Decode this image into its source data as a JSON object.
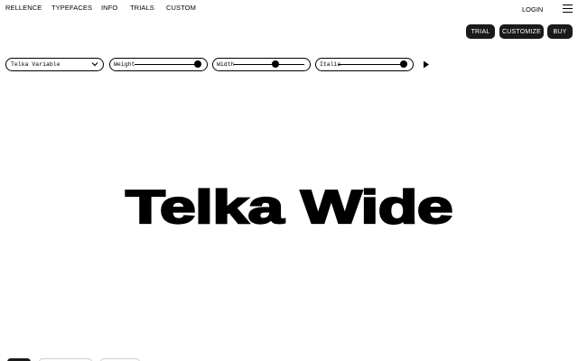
{
  "nav": {
    "brand": "RELLENCE",
    "links": [
      "TYPEFACES",
      "INFO",
      "TRIALS",
      "CUSTOM"
    ],
    "login": "LOGIN",
    "menu_icon": "hamburger-icon"
  },
  "actions": {
    "trial": "TRIAL",
    "customize": "CUSTOMIZE",
    "buy": "BUY"
  },
  "controls": {
    "family": {
      "value": "Telka Variable",
      "icon": "chevron-down-icon"
    },
    "sliders": [
      {
        "label": "Weight",
        "level": 1.0
      },
      {
        "label": "Width",
        "level": 0.62
      },
      {
        "label": "Italic",
        "level": 1.0
      }
    ],
    "play_icon": "play-icon"
  },
  "hero": {
    "text": "Telka Wide"
  },
  "colors": {
    "ink": "#000000",
    "pill_bg": "#1a1a1a",
    "pill_text": "#ffffff",
    "background": "#ffffff"
  }
}
